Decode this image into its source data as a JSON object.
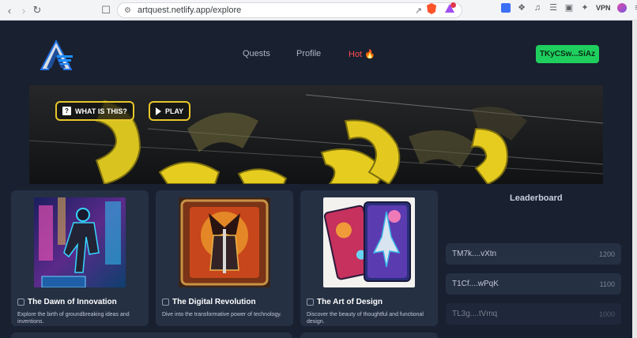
{
  "browser": {
    "url": "artquest.netlify.app/explore",
    "vpn_label": "VPN"
  },
  "header": {
    "nav": [
      "Quests",
      "Profile",
      "Hot 🔥"
    ],
    "wallet": "TKyCSw...SiAz"
  },
  "banner": {
    "what_label": "WHAT IS THIS?",
    "play_label": "PLAY"
  },
  "cards": [
    {
      "title": "The Dawn of Innovation",
      "desc": "Explore the birth of groundbreaking ideas and inventions."
    },
    {
      "title": "The Digital Revolution",
      "desc": "Dive into the transformative power of technology."
    },
    {
      "title": "The Art of Design",
      "desc": "Discover the beauty of thoughtful and functional design."
    }
  ],
  "leaderboard": {
    "title": "Leaderboard",
    "rows": [
      {
        "addr": "TM7k....vXtn",
        "score": "1200"
      },
      {
        "addr": "T1Cf....wPqK",
        "score": "1100"
      },
      {
        "addr": "TL3g....tVmq",
        "score": "1000"
      }
    ]
  },
  "colors": {
    "wallet": "#1fcf5e",
    "hot": "#ff4d4d",
    "accent_yellow": "#e8c72a"
  }
}
